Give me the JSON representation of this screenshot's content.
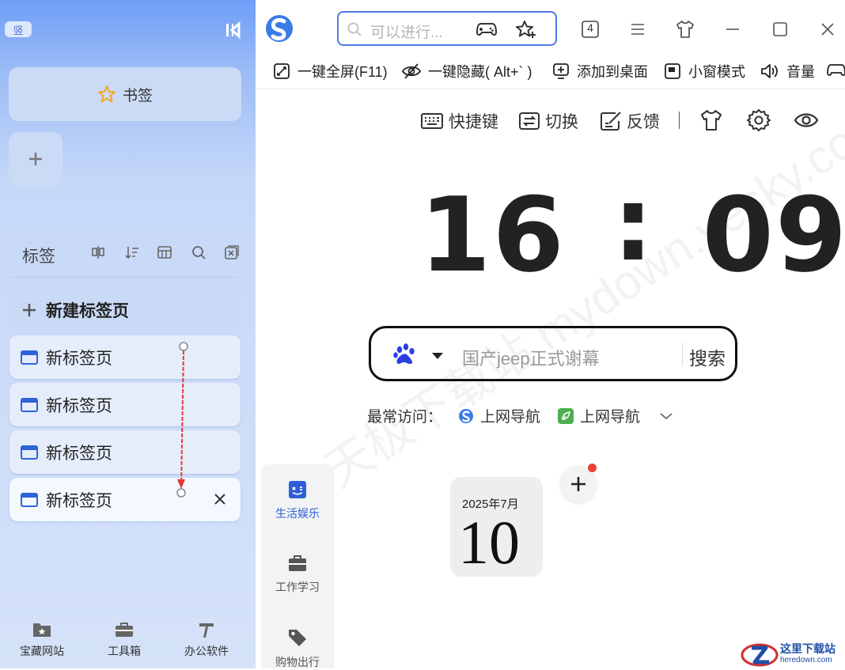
{
  "sidebar": {
    "orientation_label": "竖",
    "bookmark_label": "书签",
    "tabs_title": "标签",
    "new_tab_label": "新建标签页",
    "tabs": [
      {
        "title": "新标签页",
        "active": false
      },
      {
        "title": "新标签页",
        "active": false
      },
      {
        "title": "新标签页",
        "active": false
      },
      {
        "title": "新标签页",
        "active": true
      }
    ],
    "bottom_nav": [
      {
        "label": "宝藏网站",
        "icon": "treasure-folder-icon"
      },
      {
        "label": "工具箱",
        "icon": "toolbox-icon"
      },
      {
        "label": "办公软件",
        "icon": "office-app-icon"
      }
    ]
  },
  "topbar": {
    "search_placeholder": "可以进行...",
    "tab_count": "4"
  },
  "subtoolbar": [
    {
      "label": "一键全屏(F11)",
      "icon": "fullscreen-icon"
    },
    {
      "label": "一键隐藏( Alt+` )",
      "icon": "hide-eye-icon"
    },
    {
      "label": "添加到桌面",
      "icon": "add-desktop-icon"
    },
    {
      "label": "小窗模式",
      "icon": "mini-window-icon"
    },
    {
      "label": "音量",
      "icon": "volume-icon"
    }
  ],
  "newtab": {
    "tools": [
      {
        "label": "快捷键",
        "icon": "keyboard-icon"
      },
      {
        "label": "切换",
        "icon": "switch-icon"
      },
      {
        "label": "反馈",
        "icon": "feedback-icon"
      }
    ],
    "clock": {
      "hours": "16",
      "minutes": "09"
    },
    "search": {
      "placeholder": "国产jeep正式谢幕",
      "button": "搜索",
      "engine": "baidu-paw-icon"
    },
    "frequent": {
      "label": "最常访问：",
      "links": [
        {
          "label": "上网导航",
          "icon": "sogou-logo-icon"
        },
        {
          "label": "上网导航",
          "icon": "green-leaf-icon"
        }
      ]
    },
    "categories": [
      {
        "label": "生活娱乐",
        "icon": "game-icon",
        "active": true
      },
      {
        "label": "工作学习",
        "icon": "briefcase-icon",
        "active": false
      },
      {
        "label": "购物出行",
        "icon": "tag-icon",
        "active": false
      }
    ],
    "calendar": {
      "year_month": "2025年7月",
      "day": "10"
    },
    "watermark": "天极下载站  mydown.yesky.com",
    "corner_logo": {
      "title": "这里下载站",
      "url": "heredown.com"
    }
  },
  "colors": {
    "accent": "#4e79e6",
    "sidebar_top": "#6e9ef6",
    "sidebar_bottom": "#d5e2f8",
    "red_dot": "#ea4335",
    "drag_arrow": "#e53935"
  }
}
